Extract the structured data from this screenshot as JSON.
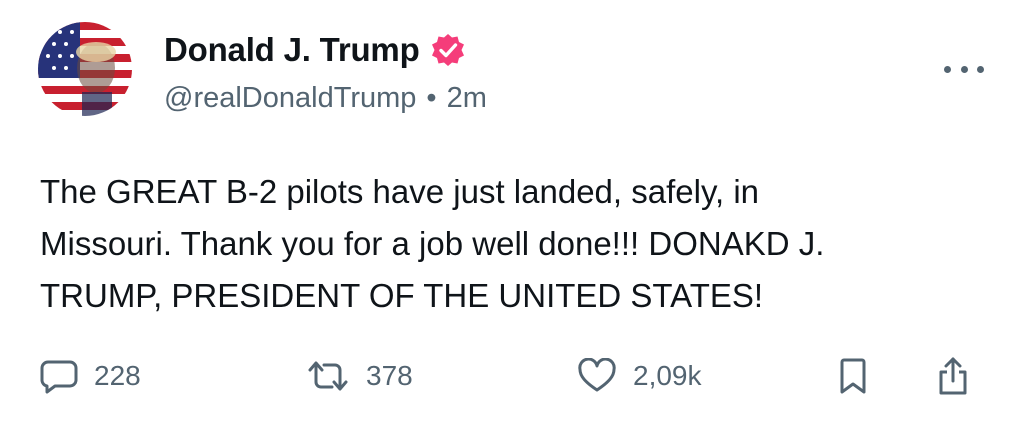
{
  "post": {
    "display_name": "Donald J. Trump",
    "verified": true,
    "handle": "@realDonaldTrump",
    "separator": "•",
    "time_ago": "2m",
    "text_lines": [
      "The GREAT B-2 pilots have just landed, safely, in",
      "Missouri. Thank you for a job well done!!! DONAKD J.",
      "TRUMP, PRESIDENT OF THE UNITED STATES!"
    ]
  },
  "actions": {
    "reply_count": "228",
    "repost_count": "378",
    "like_count": "2,09k"
  },
  "icons": {
    "verified": "verified-badge-icon",
    "more": "more-options-icon",
    "reply": "reply-bubble-icon",
    "repost": "repost-arrows-icon",
    "like": "heart-icon",
    "bookmark": "bookmark-icon",
    "share": "share-icon"
  },
  "colors": {
    "text": "#0f1419",
    "secondary": "#536471",
    "verified_badge": "#f53d7a"
  }
}
